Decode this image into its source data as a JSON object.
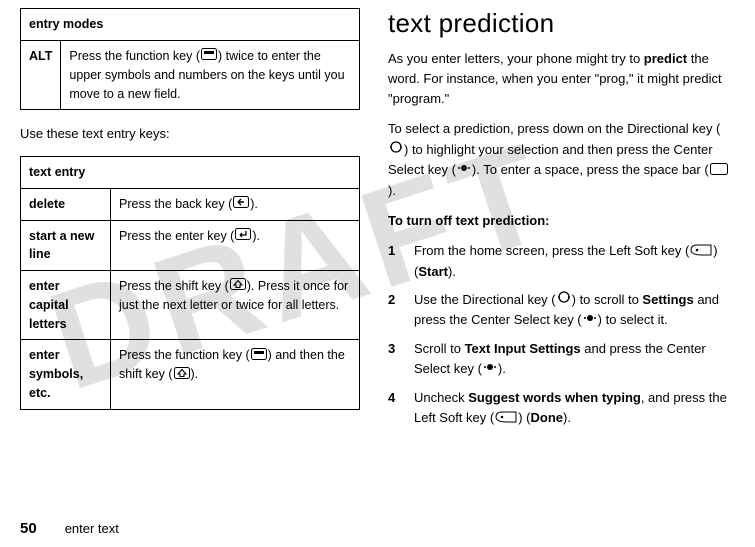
{
  "watermark": "DRAFT",
  "left": {
    "entry_modes": {
      "header": "entry modes",
      "alt_label": "ALT",
      "alt_desc_before": "Press the function key (",
      "alt_desc_after": ") twice to enter the upper symbols and numbers on the keys until you move to a new field."
    },
    "between": "Use these text entry keys:",
    "text_entry": {
      "header": "text entry",
      "rows": {
        "delete": {
          "label": "delete",
          "before": "Press the back key (",
          "after": ")."
        },
        "newline": {
          "label": "start a new line",
          "before": "Press the enter key (",
          "after": ")."
        },
        "capitals": {
          "label": "enter capital letters",
          "before": "Press the shift key (",
          "after": "). Press it once for just the next letter or twice for all letters."
        },
        "symbols": {
          "label": "enter symbols, etc.",
          "before": "Press the function key (",
          "mid": ") and then the shift key (",
          "after": ")."
        }
      }
    }
  },
  "right": {
    "title": "text prediction",
    "p1_a": "As you enter letters, your phone might try to ",
    "p1_bold": "predict",
    "p1_b": " the word. For instance, when you enter \"prog,\" it might predict \"program.\"",
    "p2_a": "To select a prediction, press down on the Directional key (",
    "p2_b": ") to highlight your selection and then press the Center Select key (",
    "p2_c": "). To enter a space, press the space bar (",
    "p2_d": ").",
    "turnoff_heading": "To turn off text prediction:",
    "steps": {
      "s1_a": "From the home screen, press the Left Soft key (",
      "s1_b": ") (",
      "s1_label": "Start",
      "s1_c": ").",
      "s2_a": "Use the Directional key (",
      "s2_b": ") to scroll to ",
      "s2_label": "Settings",
      "s2_c": " and press the Center Select key (",
      "s2_d": ") to select it.",
      "s3_a": "Scroll to ",
      "s3_label": "Text Input Settings",
      "s3_b": " and press the Center Select key (",
      "s3_c": ").",
      "s4_a": "Uncheck ",
      "s4_label": "Suggest words when typing",
      "s4_b": ", and press the Left Soft key (",
      "s4_c": ") (",
      "s4_done": "Done",
      "s4_d": ")."
    }
  },
  "footer": {
    "page": "50",
    "section": "enter text"
  }
}
